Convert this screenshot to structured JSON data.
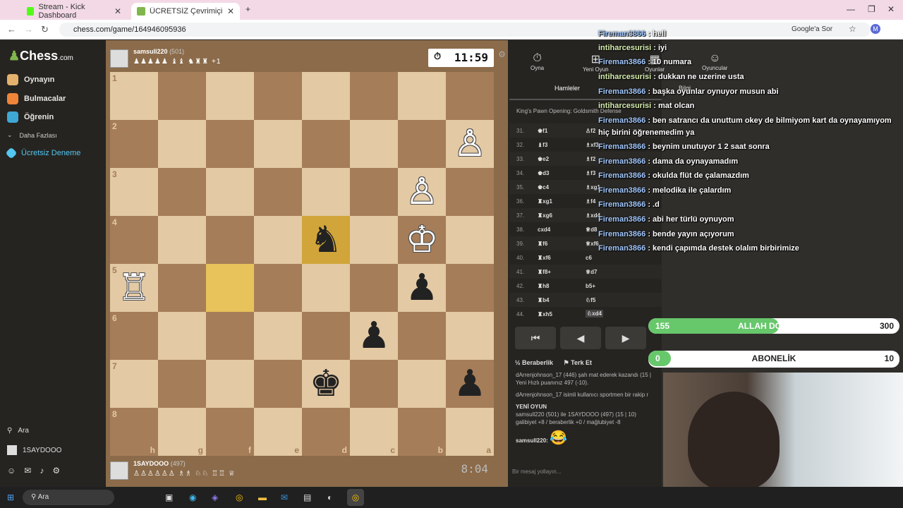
{
  "browser": {
    "tabs": [
      {
        "title": "Stream - Kick Dashboard",
        "color": "#53fc18"
      },
      {
        "title": "ÜCRETSİZ Çevrimiçi Satranç",
        "color": "#81b64c"
      }
    ],
    "url": "chess.com/game/164946095936",
    "google_btn": "Google'a Sor",
    "profile_initial": "M"
  },
  "sidebar": {
    "logo": "Chess",
    "logo_suffix": ".com",
    "items": [
      {
        "label": "Oynayın",
        "icon": "pawn-icon",
        "color": "#e4b26d"
      },
      {
        "label": "Bulmacalar",
        "icon": "puzzle-icon",
        "color": "#f08438"
      },
      {
        "label": "Öğrenin",
        "icon": "learn-icon",
        "color": "#3fa7d6"
      },
      {
        "label": "Daha Fazlası",
        "icon": "chevron-down-icon",
        "color": "#bbb"
      },
      {
        "label": "Ücretsiz Deneme",
        "icon": "diamond-icon",
        "color": "#53c7f0"
      }
    ],
    "search": "Ara",
    "username": "1SAYDOOO"
  },
  "game": {
    "top_player": {
      "name": "samsull220",
      "rating": "(501)",
      "captured": "♟♟♟♟♟ ♝♝ ♞♜♜ +1"
    },
    "bottom_player": {
      "name": "1SAYDOOO",
      "rating": "(497)",
      "captured": "♙♙♙♙♙♙ ♗♗ ♘♘ ♖♖ ♕"
    },
    "top_clock": "11:59",
    "bottom_clock": "8:04",
    "ranks": [
      "1",
      "2",
      "3",
      "4",
      "5",
      "6",
      "7",
      "8"
    ],
    "files": [
      "h",
      "g",
      "f",
      "e",
      "d",
      "c",
      "b",
      "a"
    ]
  },
  "right_panel": {
    "tabs": [
      "Oyna",
      "Yeni Oyun",
      "Oyunlar",
      "Oyuncular"
    ],
    "subtabs": [
      "Hamleler",
      "Bilgi"
    ],
    "opening": "King's Pawn Opening: Goldsmith Defense",
    "moves": [
      {
        "n": "31.",
        "w": "♚f1",
        "b": "♙f2"
      },
      {
        "n": "32.",
        "w": "♝f3",
        "b": "♗xf3"
      },
      {
        "n": "33.",
        "w": "♚e2",
        "b": "♗f2"
      },
      {
        "n": "34.",
        "w": "♚d3",
        "b": "♗f3"
      },
      {
        "n": "35.",
        "w": "♚c4",
        "b": "♗xg1"
      },
      {
        "n": "36.",
        "w": "♜xg1",
        "b": "♗f4"
      },
      {
        "n": "37.",
        "w": "♜xg6",
        "b": "♗xd4"
      },
      {
        "n": "38.",
        "w": "cxd4",
        "b": "♕d8"
      },
      {
        "n": "39.",
        "w": "♜f6",
        "b": "♕xf6"
      },
      {
        "n": "40.",
        "w": "♜xf6",
        "b": "c6"
      },
      {
        "n": "41.",
        "w": "♜f8+",
        "b": "♕d7"
      },
      {
        "n": "42.",
        "w": "♜h8",
        "b": "b5+"
      },
      {
        "n": "43.",
        "w": "♜b4",
        "b": "♘f5"
      },
      {
        "n": "44.",
        "w": "♜xh5",
        "b": "♘xd4"
      }
    ],
    "controls": [
      "⏮",
      "◀",
      "▶",
      "▷",
      "⏭"
    ],
    "draw": "Beraberlik",
    "resign": "Terk Et",
    "log": [
      "dArrenjohnson_17 (446) şah mat ederek kazandı (15 |",
      "Yeni Hızlı puanınız 497 (-10).",
      "dArrenjohnson_17 isimli kullanıcı sportmen bir rakip r",
      "YENİ OYUN",
      "samsull220 (501) ile 1SAYDOOO (497) (15 | 10)",
      "galibiyet +8 / beraberlik +0 / mağlubiyet -8",
      "samsull220:"
    ],
    "emoji": "😂",
    "chat_placeholder": "Bir mesaj yollayın..."
  },
  "stream_chat": [
    {
      "user": "Fireman3866",
      "msg": "hell"
    },
    {
      "user": "intiharcesurisi",
      "msg": "iyi"
    },
    {
      "user": "Fireman3866",
      "msg": "10 numara"
    },
    {
      "user": "intiharcesurisi",
      "msg": "dukkan ne uzerine usta"
    },
    {
      "user": "Fireman3866",
      "msg": "başka oyunlar oynuyor musun abi"
    },
    {
      "user": "intiharcesurisi",
      "msg": "mat olcan"
    },
    {
      "user": "Fireman3866",
      "msg": "ben satrancı da unuttum okey de bilmiyom kart da oynayamıyom"
    },
    {
      "user": "",
      "msg": "hiç birini öğrenemedim ya"
    },
    {
      "user": "Fireman3866",
      "msg": "beynim unutuyor 1 2 saat sonra"
    },
    {
      "user": "Fireman3866",
      "msg": "dama da oynayamadım"
    },
    {
      "user": "Fireman3866",
      "msg": "okulda flüt de çalamazdım"
    },
    {
      "user": "Fireman3866",
      "msg": "melodika ile çalardım"
    },
    {
      "user": "Fireman3866",
      "msg": ".d"
    },
    {
      "user": "Fireman3866",
      "msg": "abi her türlü oynuyom"
    },
    {
      "user": "Fireman3866",
      "msg": "bende yayın açıyorum"
    },
    {
      "user": "Fireman3866",
      "msg": "kendi çapımda destek olalım birbirimize"
    }
  ],
  "goals": [
    {
      "left": "155",
      "label": "ALLAH DOSTLAR",
      "right": "300",
      "progress": 0.52
    },
    {
      "left": "0",
      "label": "ABONELİK",
      "right": "10",
      "progress": 0.09
    }
  ],
  "taskbar": {
    "search": "Ara"
  }
}
